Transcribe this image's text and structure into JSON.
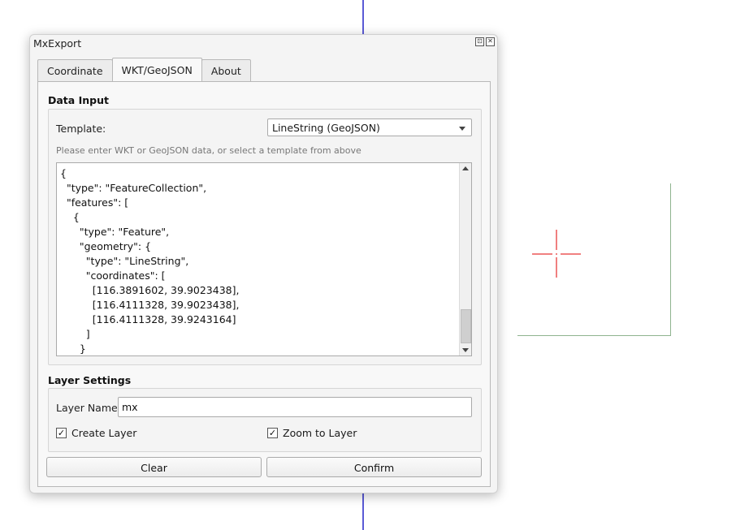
{
  "dialog": {
    "title": "MxExport",
    "restore_glyph": "⊡",
    "close_glyph": "✕"
  },
  "tabs": [
    {
      "label": "Coordinate"
    },
    {
      "label": "WKT/GeoJSON"
    },
    {
      "label": "About"
    }
  ],
  "data_input": {
    "section_title": "Data Input",
    "template_label": "Template:",
    "template_value": "LineString (GeoJSON)",
    "hint": "Please enter WKT or GeoJSON data, or select a template from above",
    "text": "{\n  \"type\": \"FeatureCollection\",\n  \"features\": [\n    {\n      \"type\": \"Feature\",\n      \"geometry\": {\n        \"type\": \"LineString\",\n        \"coordinates\": [\n          [116.3891602, 39.9023438],\n          [116.4111328, 39.9023438],\n          [116.4111328, 39.9243164]\n        ]\n      }"
  },
  "layer_settings": {
    "section_title": "Layer Settings",
    "layer_name_label": "Layer Name:",
    "layer_name_value": "mx",
    "create_layer_label": "Create Layer",
    "create_layer_checked": true,
    "zoom_to_layer_label": "Zoom to Layer",
    "zoom_to_layer_checked": true
  },
  "buttons": {
    "clear": "Clear",
    "confirm": "Confirm"
  },
  "glyphs": {
    "check": "✓"
  },
  "colors": {
    "axis_line": "#5b5bd6",
    "rect_line": "#8fb48f",
    "crosshair": "#f08080"
  }
}
